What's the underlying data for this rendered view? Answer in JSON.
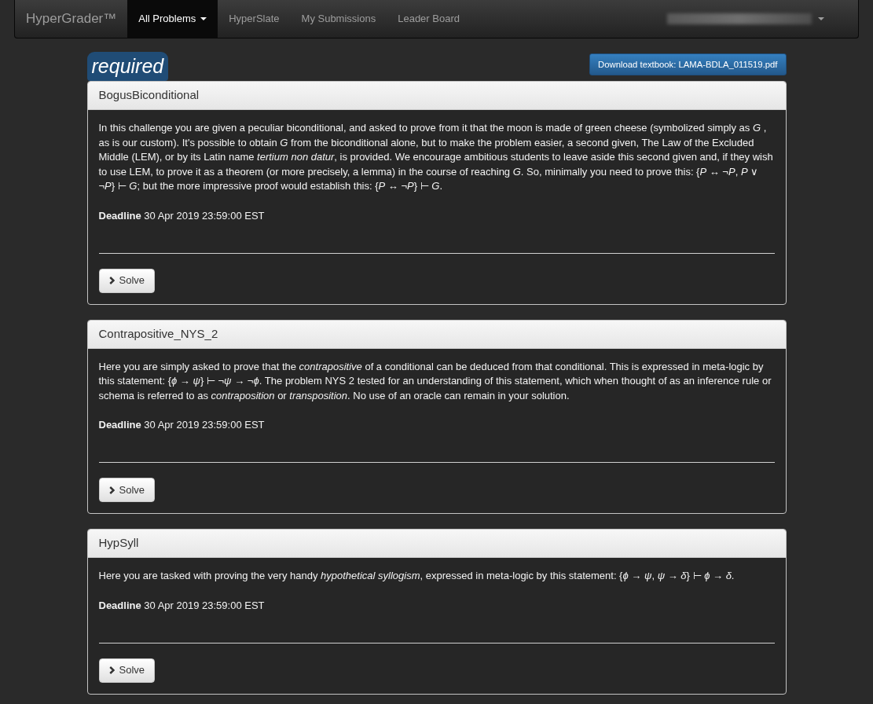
{
  "navbar": {
    "brand": "HyperGrader™",
    "items": [
      {
        "label": "All Problems",
        "selected": true,
        "dropdown": true
      },
      {
        "label": "HyperSlate",
        "selected": false,
        "dropdown": false
      },
      {
        "label": "My Submissions",
        "selected": false,
        "dropdown": false
      },
      {
        "label": "Leader Board",
        "selected": false,
        "dropdown": false
      }
    ]
  },
  "section_badge": "required",
  "download_button": "Download textbook: LAMA-BDLA_011519.pdf",
  "problems": [
    {
      "title": "BogusBiconditional",
      "description": "In this challenge you are given a peculiar biconditional, and asked to prove from it that the moon is made of green cheese (symbolized simply as *G* , as is our custom). It's possible to obtain *G* from the biconditional alone, but to make the problem easier, a second given, The Law of the Excluded Middle (LEM), or by its Latin name *tertium non datur*, is provided. We encourage ambitious students to leave aside this second given and, if they wish to use LEM, to prove it as a theorem (or more precisely, a lemma) in the course of reaching *G*. So, minimally you need to prove this: {*P* ↔ ¬*P*, *P* ∨ ¬*P*} ⊢ *G*; but the more impressive proof would establish this: {*P* ↔ ¬*P*} ⊢ *G*.",
      "deadline": "**Deadline** 30 Apr 2019 23:59:00 EST",
      "solve_button": "Solve"
    },
    {
      "title": "Contrapositive_NYS_2",
      "description": "Here you are simply asked to prove that the *contrapositive* of a conditional can be deduced from that conditional. This is expressed in meta-logic by this statement: {*ϕ* → *ψ*} ⊢ ¬*ψ* → ¬*ϕ*. The problem NYS 2 tested for an understanding of this statement, which when thought of as an inference rule or schema is referred to as *contraposition* or *transposition*. No use of an oracle can remain in your solution.",
      "deadline": "**Deadline** 30 Apr 2019 23:59:00 EST",
      "solve_button": "Solve"
    },
    {
      "title": "HypSyll",
      "description": "Here you are tasked with proving the very handy *hypothetical syllogism*, expressed in meta-logic by this statement: {*ϕ* → *ψ*, *ψ* → *δ*} ⊢ *ϕ* → *δ*.",
      "deadline": "**Deadline** 30 Apr 2019 23:59:00 EST",
      "solve_button": "Solve"
    }
  ]
}
